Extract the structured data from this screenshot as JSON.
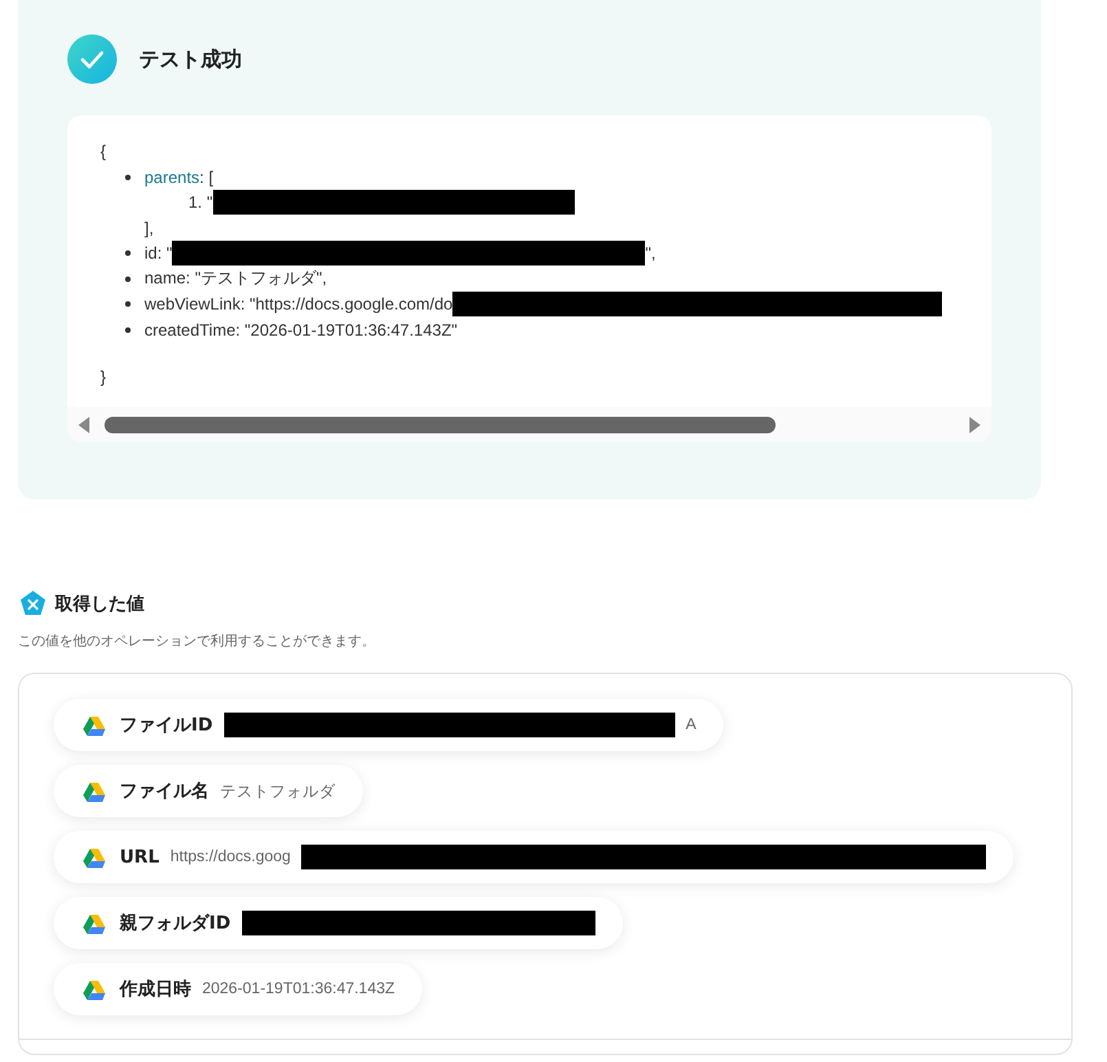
{
  "result": {
    "title": "テスト成功",
    "code": {
      "open": "{",
      "close": "}",
      "entries": [
        {
          "key": "parents",
          "highlighted": true,
          "text": ": [",
          "items": [
            {
              "marker": "1.",
              "text": "\"",
              "redacted": true
            }
          ],
          "close": "],"
        },
        {
          "key": "id",
          "highlighted": false,
          "text": ": \"",
          "redacted": true,
          "after": "\","
        },
        {
          "key": "name",
          "highlighted": false,
          "text": ": \"テストフォルダ\","
        },
        {
          "key": "webViewLink",
          "highlighted": false,
          "text": ": \"https://docs.google.com/do",
          "redacted": true
        },
        {
          "key": "createdTime",
          "highlighted": false,
          "text": ": \"2026-01-19T01:36:47.143Z\""
        }
      ]
    }
  },
  "values_section": {
    "title": "取得した値",
    "description": "この値を他のオペレーションで利用することができます。",
    "items": [
      {
        "label": "ファイルID",
        "redacted": true,
        "value_after": "A"
      },
      {
        "label": "ファイル名",
        "value": "テストフォルダ"
      },
      {
        "label": "URL",
        "value": "https://docs.goog",
        "redacted": true
      },
      {
        "label": "親フォルダID",
        "redacted": true
      },
      {
        "label": "作成日時",
        "value": "2026-01-19T01:36:47.143Z"
      }
    ]
  }
}
